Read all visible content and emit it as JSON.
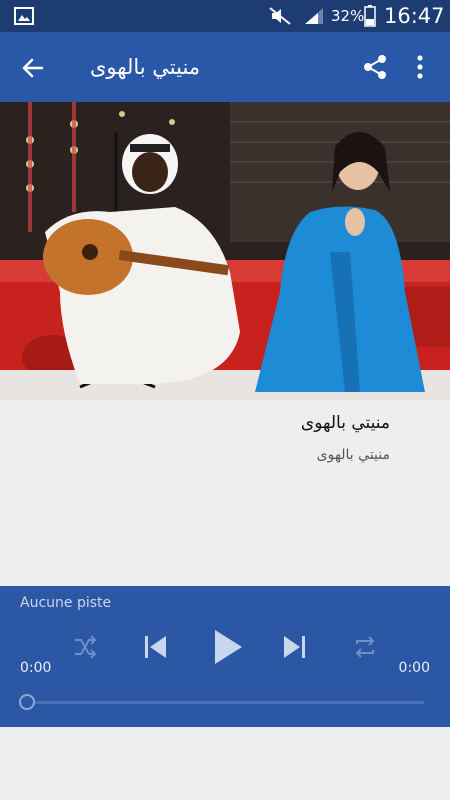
{
  "status_bar": {
    "battery": "32%",
    "time": "16:47",
    "icons": [
      "gallery-icon",
      "mute-icon",
      "signal-icon",
      "battery-icon"
    ]
  },
  "app_bar": {
    "title": "منيتي بالهوى",
    "icons": [
      "back-arrow-icon",
      "share-icon",
      "more-vert-icon"
    ]
  },
  "track": {
    "title": "منيتي بالهوى",
    "subtitle": "منيتي بالهوى"
  },
  "player": {
    "now_playing": "Aucune piste",
    "time_elapsed": "0:00",
    "time_total": "0:00",
    "progress": 0,
    "controls": [
      "shuffle-icon",
      "previous-icon",
      "play-icon",
      "next-icon",
      "repeat-icon"
    ]
  },
  "colors": {
    "status_bar": "#1c3c72",
    "app_bar": "#2a58a8",
    "player": "#2b57a4",
    "background": "#eeeeee"
  }
}
